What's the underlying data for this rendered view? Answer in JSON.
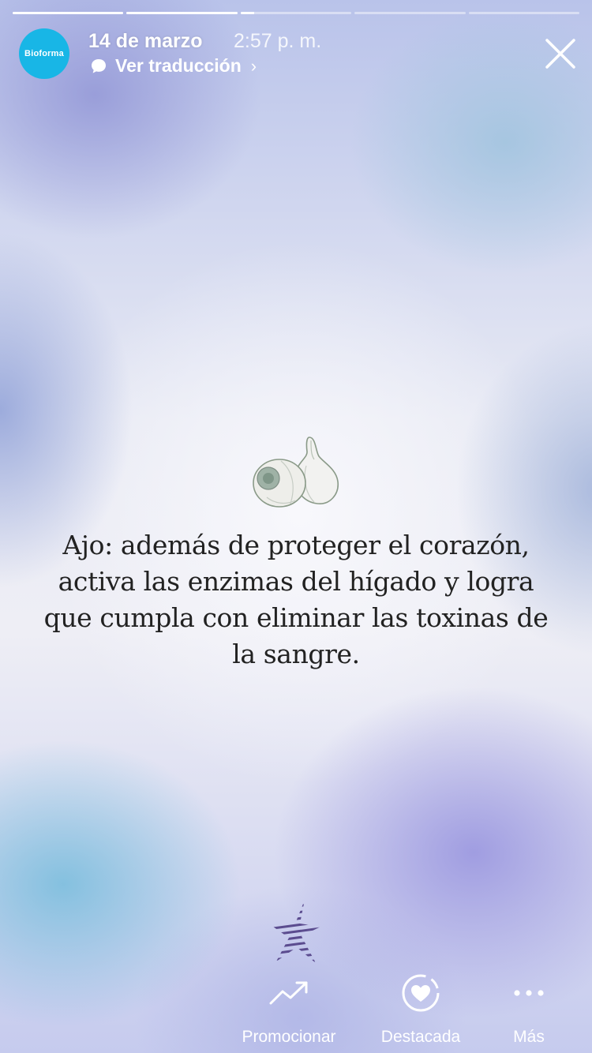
{
  "story": {
    "progress_segments": [
      1,
      1,
      0.12,
      0,
      0
    ],
    "date": "14 de marzo",
    "time": "2:57 p. m.",
    "translate_label": "Ver traducción",
    "chevron": "›",
    "account_logo_text": "Bioforma"
  },
  "content": {
    "quote": "Ajo: además de proteger el corazón, activa las enzimas del hígado y logra que cumpla con eliminar las toxinas de la sangre."
  },
  "actions": {
    "promote_label": "Promocionar",
    "highlight_label": "Destacada",
    "more_label": "Más"
  },
  "icons": {
    "close": "close-icon",
    "translate": "speech-bubble-icon",
    "promote": "trend-arrow-icon",
    "highlight": "heart-circle-icon",
    "more": "ellipsis-icon",
    "garlic": "garlic-icon",
    "star": "striped-star-icon"
  },
  "colors": {
    "avatar_bg": "#18b6e6",
    "text_dark": "#222222",
    "ui_white": "#ffffff"
  }
}
